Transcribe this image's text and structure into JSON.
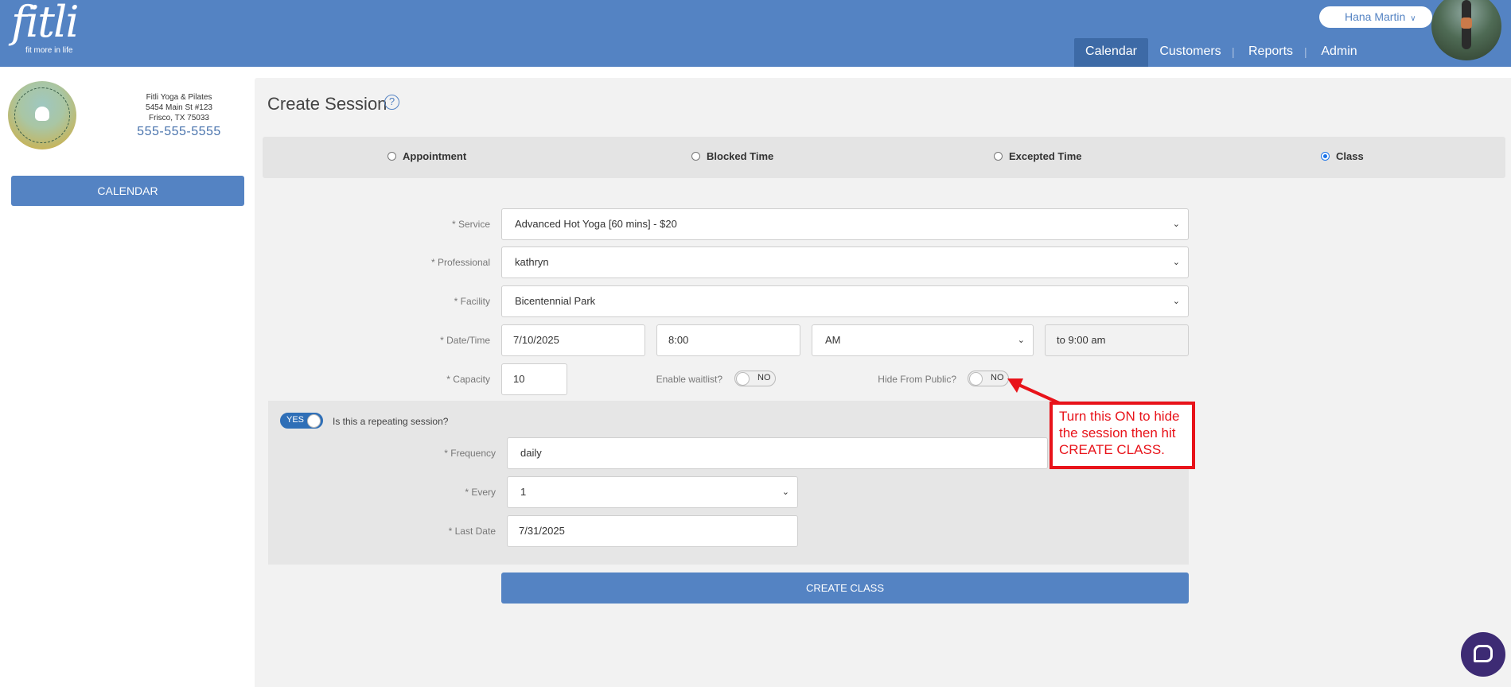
{
  "header": {
    "logo_word": "fitli",
    "logo_tagline": "fit more in life",
    "user_name": "Hana Martin",
    "nav": [
      {
        "label": "Calendar",
        "active": true
      },
      {
        "label": "Customers",
        "active": false
      },
      {
        "label": "Reports",
        "active": false
      },
      {
        "label": "Admin",
        "active": false
      }
    ],
    "brand_color": "#5483c3"
  },
  "sidebar": {
    "studio_name": "Fitli Yoga & Pilates",
    "address_line1": "5454 Main St #123",
    "address_line2": "Frisco, TX 75033",
    "phone": "555-555-5555",
    "calendar_button": "CALENDAR"
  },
  "form": {
    "title": "Create Session",
    "session_types": [
      {
        "label": "Appointment",
        "selected": false
      },
      {
        "label": "Blocked Time",
        "selected": false
      },
      {
        "label": "Excepted Time",
        "selected": false
      },
      {
        "label": "Class",
        "selected": true
      }
    ],
    "service": {
      "label": "* Service",
      "value": "Advanced Hot Yoga [60 mins] - $20"
    },
    "professional": {
      "label": "* Professional",
      "value": "kathryn"
    },
    "facility": {
      "label": "* Facility",
      "value": "Bicentennial Park"
    },
    "datetime": {
      "label": "* Date/Time",
      "date": "7/10/2025",
      "time": "8:00",
      "ampm": "AM",
      "end": "to 9:00 am"
    },
    "capacity": {
      "label": "* Capacity",
      "value": "10"
    },
    "waitlist": {
      "label": "Enable waitlist?",
      "state": "NO"
    },
    "hide_public": {
      "label": "Hide From Public?",
      "state": "NO"
    },
    "repeating": {
      "toggle_state": "YES",
      "question": "Is this a repeating session?",
      "frequency": {
        "label": "* Frequency",
        "value": "daily"
      },
      "every": {
        "label": "* Every",
        "value": "1"
      },
      "last_date": {
        "label": "* Last Date",
        "value": "7/31/2025"
      }
    },
    "submit": "CREATE CLASS"
  },
  "annotation": {
    "text": "Turn this ON to hide the session then hit CREATE CLASS.",
    "color": "#e8131a"
  }
}
